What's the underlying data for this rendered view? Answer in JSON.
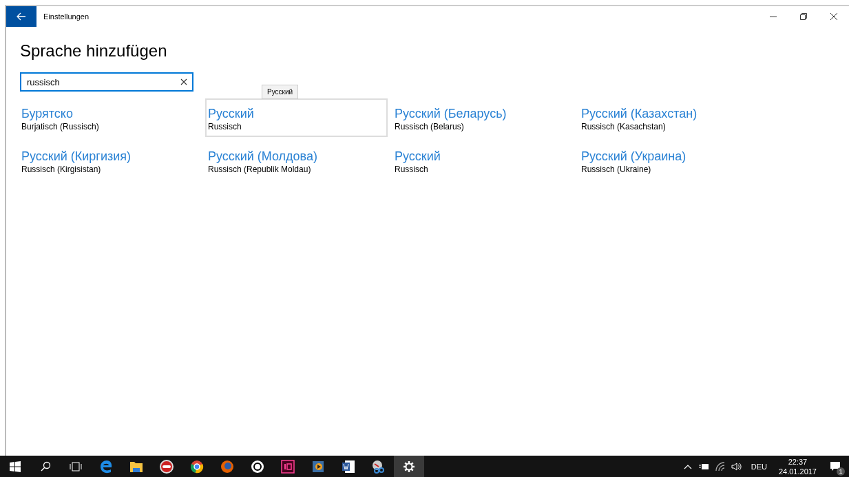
{
  "window": {
    "title": "Einstellungen"
  },
  "page_title": "Sprache hinzufügen",
  "search": {
    "value": "russisch"
  },
  "tooltip": "Русский",
  "languages": [
    {
      "name": "Бурятско",
      "description": "Burjatisch (Russisch)",
      "hovered": false
    },
    {
      "name": "Русский",
      "description": "Russisch",
      "hovered": true
    },
    {
      "name": "Русский (Беларусь)",
      "description": "Russisch (Belarus)",
      "hovered": false
    },
    {
      "name": "Русский (Казахстан)",
      "description": "Russisch (Kasachstan)",
      "hovered": false
    },
    {
      "name": "Русский (Киргизия)",
      "description": "Russisch (Kirgisistan)",
      "hovered": false
    },
    {
      "name": "Русский (Молдова)",
      "description": "Russisch (Republik Moldau)",
      "hovered": false
    },
    {
      "name": "Русский",
      "description": "Russisch",
      "hovered": false
    },
    {
      "name": "Русский (Украина)",
      "description": "Russisch (Ukraine)",
      "hovered": false
    }
  ],
  "taskbar": {
    "apps": [
      {
        "kind": "edge",
        "active": false
      },
      {
        "kind": "explorer",
        "active": false
      },
      {
        "kind": "nero",
        "active": false
      },
      {
        "kind": "chrome",
        "active": false
      },
      {
        "kind": "firefox",
        "active": false
      },
      {
        "kind": "ring",
        "active": false
      },
      {
        "kind": "indesign",
        "active": false
      },
      {
        "kind": "media",
        "active": false
      },
      {
        "kind": "word",
        "active": false
      },
      {
        "kind": "snipping",
        "active": false
      },
      {
        "kind": "settings",
        "active": true
      }
    ],
    "input_language": "DEU",
    "time": "22:37",
    "date": "24.01.2017",
    "notification_count": "1"
  }
}
